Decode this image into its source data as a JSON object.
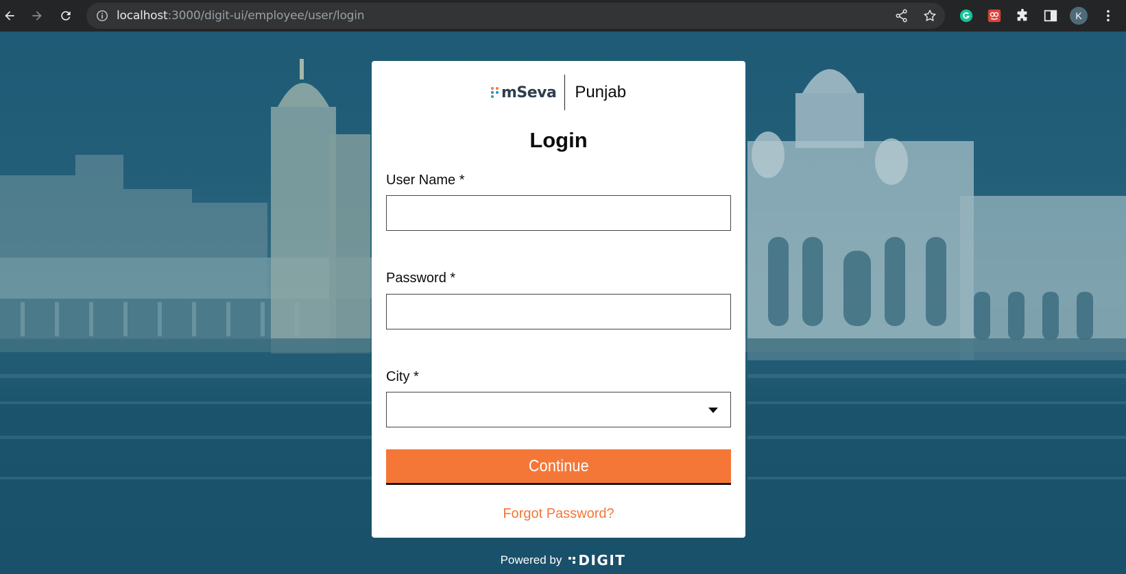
{
  "browser": {
    "url_host": "localhost",
    "url_rest": ":3000/digit-ui/employee/user/login",
    "profile_initial": "K",
    "icons": [
      "back-arrow-icon",
      "forward-arrow-icon",
      "reload-icon",
      "info-icon",
      "share-icon",
      "bookmark-star-icon",
      "grammarly-extension-icon",
      "extension-red-icon",
      "puzzle-extensions-icon",
      "side-panel-icon",
      "profile-avatar",
      "kebab-menu-icon"
    ]
  },
  "brand": {
    "logo_text": "mSeva",
    "city": "Punjab"
  },
  "login": {
    "title": "Login",
    "username_label": "User Name *",
    "username_value": "",
    "password_label": "Password *",
    "password_value": "",
    "city_label": "City *",
    "city_value": "",
    "continue_label": "Continue",
    "forgot_label": "Forgot Password?"
  },
  "footer": {
    "powered_by": "Powered by",
    "digit_logo_text": "DIGIT"
  },
  "colors": {
    "accent": "#f47738",
    "overlay": "#1f5670",
    "card": "#ffffff",
    "chrome": "#242526"
  }
}
